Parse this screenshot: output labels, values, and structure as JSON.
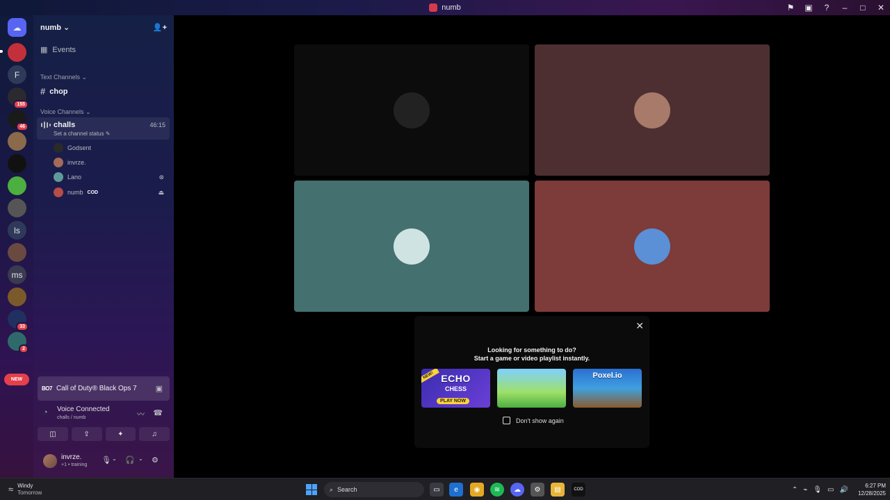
{
  "window": {
    "title": "numb",
    "controls": [
      "inbox-icon",
      "cast-icon",
      "help-icon",
      "minimize-icon",
      "maximize-icon",
      "close-icon"
    ]
  },
  "rail": {
    "letters": [
      "F",
      "ls",
      "ms"
    ],
    "badges": [
      "155",
      "46",
      "33",
      "2"
    ],
    "new_label": "NEW"
  },
  "guild": {
    "name": "numb",
    "events_label": "Events",
    "text_category": "Text Channels",
    "text_channel": "chop",
    "voice_category": "Voice Channels",
    "voice_channel": {
      "name": "challs",
      "time": "46:15",
      "status": "Set a channel status"
    },
    "members": [
      {
        "name": "Godsent",
        "color": "#2a2a2a"
      },
      {
        "name": "invrze.",
        "color": "#a56a5a"
      },
      {
        "name": "Lano",
        "color": "#5f9a9a"
      },
      {
        "name": "numb",
        "color": "#b84c48",
        "tag": "COD"
      }
    ]
  },
  "activity": {
    "badge": "BO7",
    "game": "Call of Duty® Black Ops 7"
  },
  "voice": {
    "title": "Voice Connected",
    "sub": "challs / numb"
  },
  "user": {
    "name": "invrze.",
    "status": "+1 • training"
  },
  "tiles": [
    {
      "color": "#0c0c0c",
      "avatar": "#222222"
    },
    {
      "color": "#4d2f31",
      "avatar": "#a87a6a"
    },
    {
      "color": "#44706f",
      "avatar": "#cfe3e3"
    },
    {
      "color": "#7d3b39",
      "avatar": "#5b8fd6"
    }
  ],
  "prompt": {
    "line1": "Looking for something to do?",
    "line2": "Start a game or video playlist instantly.",
    "dont_show": "Don't show again",
    "games": [
      {
        "title": "ECHO",
        "subtitle": "CHESS",
        "cta": "PLAY NOW",
        "tag": "NEW!"
      },
      {
        "title": ""
      },
      {
        "title": "Poxel.io"
      }
    ]
  },
  "taskbar": {
    "weather_title": "Windy",
    "weather_sub": "Tomorrow",
    "search": "Search",
    "time": "6:27 PM",
    "date": "12/28/2025"
  }
}
